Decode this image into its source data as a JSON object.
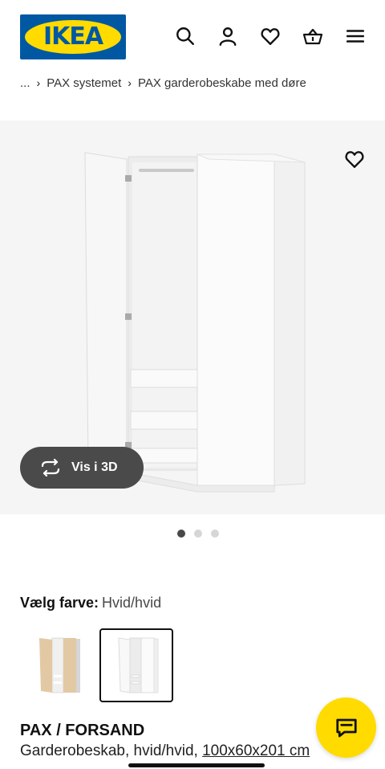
{
  "header": {
    "logo_text": "IKEA",
    "icons": [
      "search-icon",
      "user-icon",
      "heart-icon",
      "basket-icon",
      "menu-icon"
    ]
  },
  "breadcrumb": {
    "ellipsis": "...",
    "items": [
      "PAX systemet",
      "PAX garderobeskabe med døre"
    ]
  },
  "gallery": {
    "view_3d_label": "Vis i 3D",
    "dots_total": 3,
    "active_dot": 1
  },
  "colour": {
    "label": "Vælg farve:",
    "value": "Hvid/hvid",
    "options": [
      {
        "name": "white-stained-oak",
        "color": "#e2c9a4"
      },
      {
        "name": "white",
        "color": "#ffffff"
      }
    ],
    "selected_index": 1
  },
  "product": {
    "name": "PAX / FORSAND",
    "description": "Garderobeskab, hvid/hvid,",
    "size": "100x60x201 cm"
  },
  "colors": {
    "ikea_blue": "#0058a3",
    "ikea_yellow": "#ffdb00",
    "pill_bg": "#4a4a4a"
  }
}
